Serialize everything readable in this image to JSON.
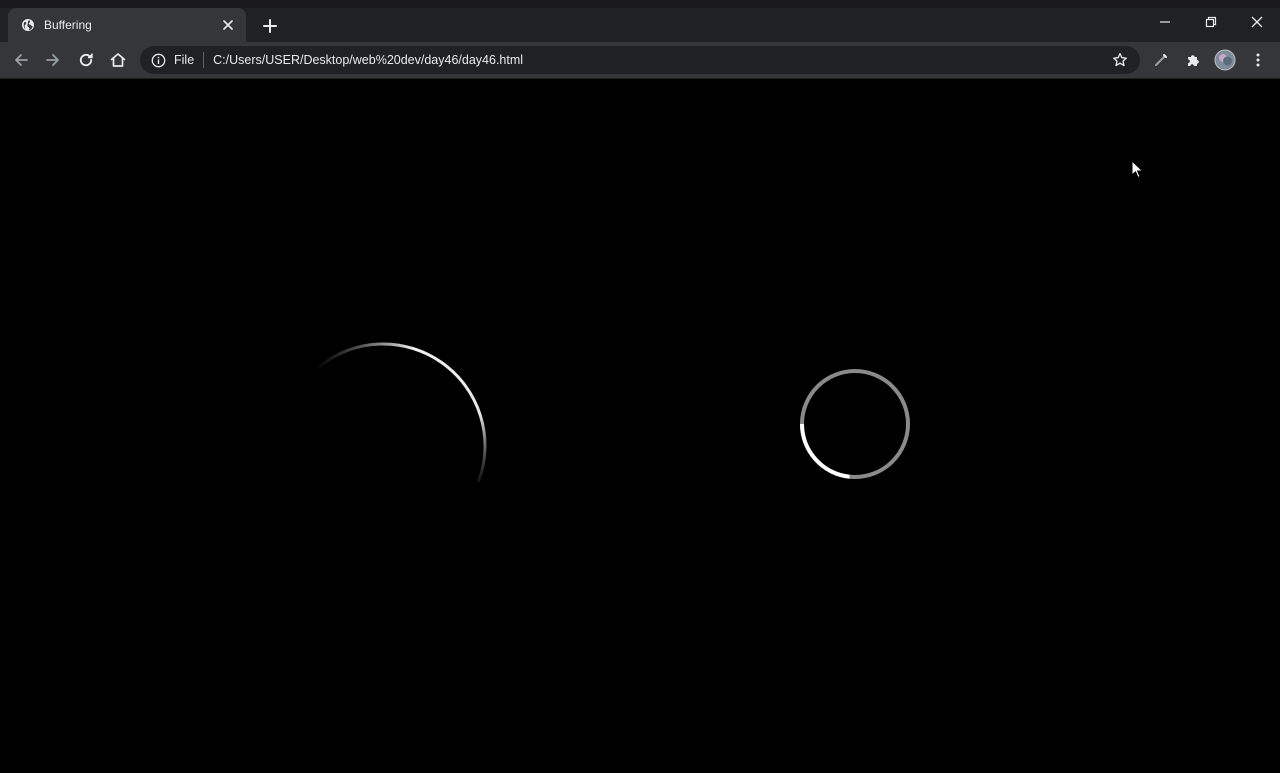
{
  "browser": {
    "tab": {
      "title": "Buffering",
      "favicon": "globe-icon"
    },
    "address": {
      "scheme_label": "File",
      "url": "C:/Users/USER/Desktop/web%20dev/day46/day46.html"
    }
  },
  "colors": {
    "tabstrip": "#202124",
    "toolbar": "#35363a",
    "omnibox": "#202124",
    "text": "#e8eaed",
    "icon": "#bdc1c6",
    "page_background": "#000000"
  },
  "loaders": [
    {
      "name": "large-arc-loader",
      "color": "#ffffff"
    },
    {
      "name": "ring-loader",
      "track_color": "#8a8a8a",
      "highlight_color": "#ffffff"
    }
  ]
}
